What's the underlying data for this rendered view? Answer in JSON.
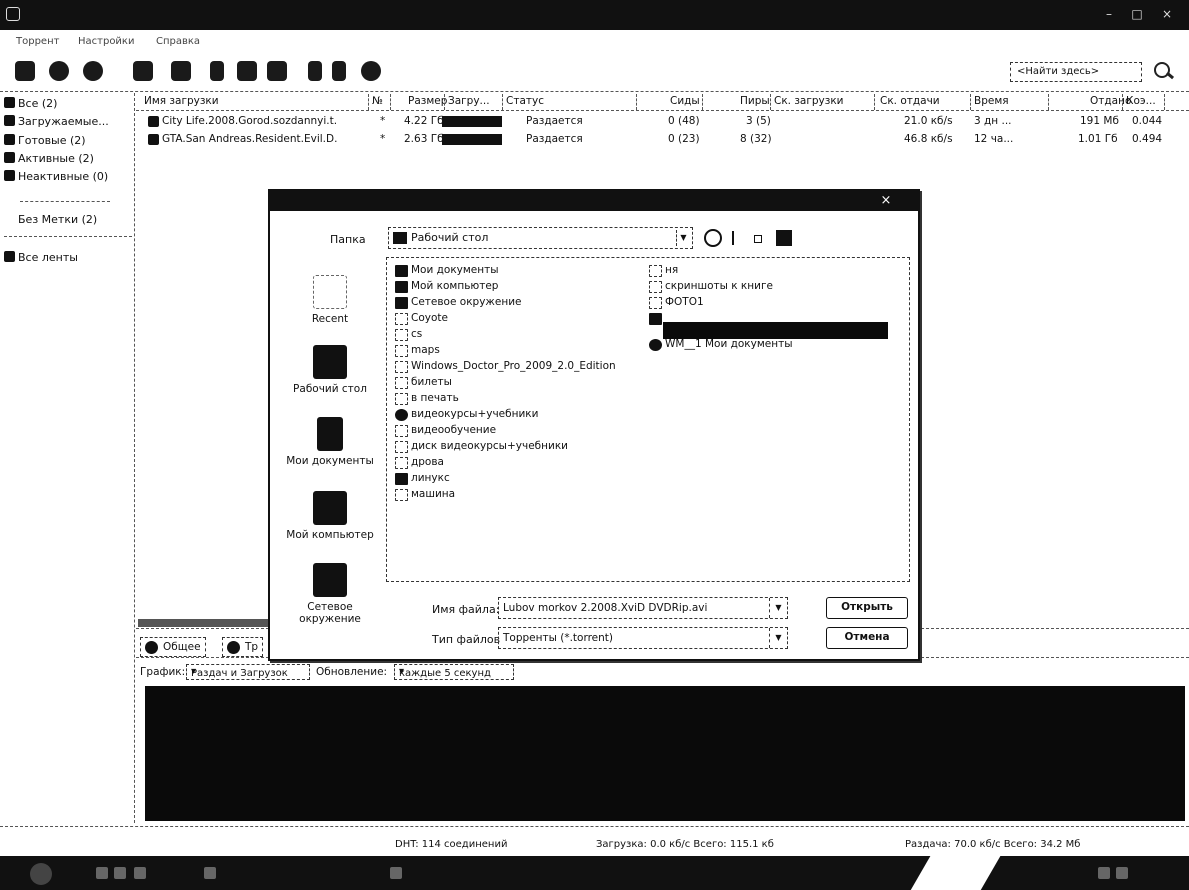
{
  "menu": [
    "Торрент",
    "Настройки",
    "Справка"
  ],
  "search": {
    "placeholder": "<Найти здесь>"
  },
  "sidebar": {
    "items": [
      {
        "label": "Все (2)"
      },
      {
        "label": "Загружаемые..."
      },
      {
        "label": "Готовые (2)"
      },
      {
        "label": "Активные (2)"
      },
      {
        "label": "Неактивные (0)"
      },
      {
        "label": "Без Метки (2)"
      },
      {
        "label": "Все ленты"
      }
    ]
  },
  "table": {
    "headers": [
      "Имя загрузки",
      "№",
      "Размер",
      "Загру...",
      "Статус",
      "Сиды",
      "Пиры",
      "Ск. загрузки",
      "Ск. отдачи",
      "Время",
      "Отдано",
      "Коэ..."
    ],
    "rows": [
      {
        "name": "City Life.2008.Gorod.sozdannyi.t.",
        "num": "*",
        "size": "4.22 Гб",
        "status": "Раздается",
        "seeds": "0 (48)",
        "peers": "3 (5)",
        "dl": "",
        "ul": "21.0 кб/s",
        "eta": "3 дн ...",
        "uploaded": "191 Мб",
        "ratio": "0.044"
      },
      {
        "name": "GTA.San Andreas.Resident.Evil.D.",
        "num": "*",
        "size": "2.63 Гб",
        "status": "Раздается",
        "seeds": "0 (23)",
        "peers": "8 (32)",
        "dl": "",
        "ul": "46.8 кб/s",
        "eta": "12 ча...",
        "uploaded": "1.01 Гб",
        "ratio": "0.494"
      }
    ]
  },
  "tabs": [
    {
      "label": "Общее"
    },
    {
      "label": "Тр"
    }
  ],
  "graph": {
    "label": "График:",
    "type_value": "Раздач и Загрузок",
    "update_label": "Обновление:",
    "update_value": "каждые 5 секунд"
  },
  "status": {
    "dht": "DHT: 114 соединений",
    "download": "Загрузка: 0.0 кб/с Всего: 115.1 кб",
    "upload": "Раздача: 70.0 кб/с Всего: 34.2 Мб"
  },
  "dialog": {
    "lookin_label": "Папка",
    "lookin_value": "Рабочий стол",
    "places": [
      "Recent",
      "Рабочий стол",
      "Мои документы",
      "Мой компьютер",
      "Сетевое окружение"
    ],
    "files_col1": [
      "Мои документы",
      "Мой компьютер",
      "Сетевое окружение",
      "Coyote",
      "cs",
      "maps",
      "Windows_Doctor_Pro_2009_2.0_Edition",
      "билеты",
      "в печать",
      "видеокурсы+учебники",
      "видеообучение",
      "диск видеокурсы+учебники",
      "дрова",
      "линукс",
      "машина"
    ],
    "files_col2": [
      "ня",
      "скриншоты к книге",
      "ФОТО1",
      "",
      "WM__1 Мои документы"
    ],
    "filename_label": "Имя файла:",
    "filename_value": "Lubov morkov 2.2008.XviD DVDRip.avi",
    "filetype_label": "Тип файлов",
    "filetype_value": "Торренты (*.torrent)",
    "open_button": "Открыть",
    "cancel_button": "Отмена"
  }
}
